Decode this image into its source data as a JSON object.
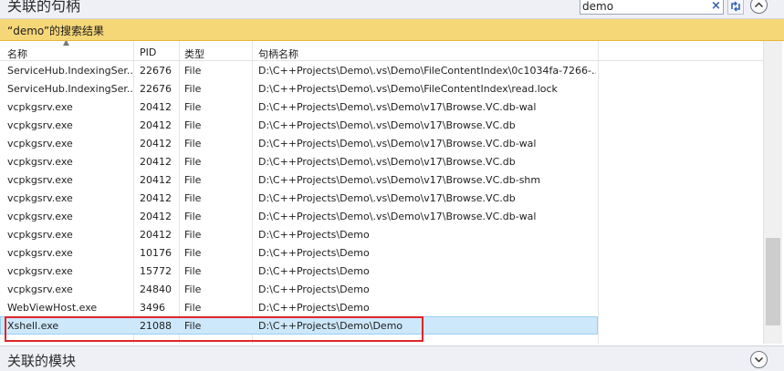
{
  "header": {
    "title": "关联的句柄",
    "search_value": "demo",
    "clear_icon": "×",
    "options_icon": "search-options-icon",
    "collapse_icon": "chevron-up-icon"
  },
  "results_banner": {
    "text": "“demo”的搜索结果"
  },
  "columns": {
    "name": "名称",
    "pid": "PID",
    "type": "类型",
    "path": "句柄名称"
  },
  "rows": [
    {
      "name": "ServiceHub.IndexingSer...",
      "pid": "22676",
      "type": "File",
      "path": "D:\\C++Projects\\Demo\\.vs\\Demo\\FileContentIndex\\0c1034fa-7266-..."
    },
    {
      "name": "ServiceHub.IndexingSer...",
      "pid": "22676",
      "type": "File",
      "path": "D:\\C++Projects\\Demo\\.vs\\Demo\\FileContentIndex\\read.lock"
    },
    {
      "name": "vcpkgsrv.exe",
      "pid": "20412",
      "type": "File",
      "path": "D:\\C++Projects\\Demo\\.vs\\Demo\\v17\\Browse.VC.db-wal"
    },
    {
      "name": "vcpkgsrv.exe",
      "pid": "20412",
      "type": "File",
      "path": "D:\\C++Projects\\Demo\\.vs\\Demo\\v17\\Browse.VC.db"
    },
    {
      "name": "vcpkgsrv.exe",
      "pid": "20412",
      "type": "File",
      "path": "D:\\C++Projects\\Demo\\.vs\\Demo\\v17\\Browse.VC.db-wal"
    },
    {
      "name": "vcpkgsrv.exe",
      "pid": "20412",
      "type": "File",
      "path": "D:\\C++Projects\\Demo\\.vs\\Demo\\v17\\Browse.VC.db"
    },
    {
      "name": "vcpkgsrv.exe",
      "pid": "20412",
      "type": "File",
      "path": "D:\\C++Projects\\Demo\\.vs\\Demo\\v17\\Browse.VC.db-shm"
    },
    {
      "name": "vcpkgsrv.exe",
      "pid": "20412",
      "type": "File",
      "path": "D:\\C++Projects\\Demo\\.vs\\Demo\\v17\\Browse.VC.db"
    },
    {
      "name": "vcpkgsrv.exe",
      "pid": "20412",
      "type": "File",
      "path": "D:\\C++Projects\\Demo\\.vs\\Demo\\v17\\Browse.VC.db-wal"
    },
    {
      "name": "vcpkgsrv.exe",
      "pid": "20412",
      "type": "File",
      "path": "D:\\C++Projects\\Demo"
    },
    {
      "name": "vcpkgsrv.exe",
      "pid": "10176",
      "type": "File",
      "path": "D:\\C++Projects\\Demo"
    },
    {
      "name": "vcpkgsrv.exe",
      "pid": "15772",
      "type": "File",
      "path": "D:\\C++Projects\\Demo"
    },
    {
      "name": "vcpkgsrv.exe",
      "pid": "24840",
      "type": "File",
      "path": "D:\\C++Projects\\Demo"
    },
    {
      "name": "WebViewHost.exe",
      "pid": "3496",
      "type": "File",
      "path": "D:\\C++Projects\\Demo"
    },
    {
      "name": "Xshell.exe",
      "pid": "21088",
      "type": "File",
      "path": "D:\\C++Projects\\Demo\\Demo",
      "selected": true
    }
  ],
  "footer": {
    "title": "关联的模块",
    "expand_icon": "chevron-down-icon"
  },
  "colors": {
    "banner": "#f6d778",
    "selection": "#cde8fb",
    "highlight": "#e0242a"
  }
}
